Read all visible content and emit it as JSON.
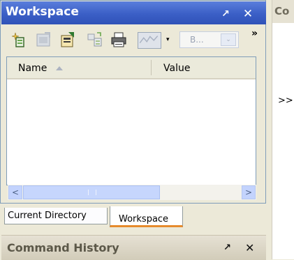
{
  "workspace": {
    "title": "Workspace",
    "undock_glyph": "↗",
    "close_glyph": "✕",
    "toolbar": {
      "icons": [
        "new-variable-icon",
        "import-data-icon",
        "save-icon",
        "open-selection-icon",
        "print-icon",
        "plot-selection-icon"
      ],
      "plot_dropdown_glyph": "▾",
      "base_select": {
        "value": "B...",
        "arrow": "⌄"
      },
      "overflow_glyph": "»"
    },
    "columns": [
      {
        "label": "Name",
        "sorted": "ascending"
      },
      {
        "label": "Value"
      }
    ],
    "scrollbar": {
      "left_glyph": "<",
      "right_glyph": ">"
    }
  },
  "tabs": [
    {
      "label": "Current Directory",
      "active": false
    },
    {
      "label": "Workspace",
      "active": true
    }
  ],
  "command_history": {
    "title": "Command History",
    "undock_glyph": "↗",
    "close_glyph": "✕"
  },
  "command_window": {
    "title": "Co",
    "prompt": ">>"
  },
  "colors": {
    "active_title": "#3b5fc6",
    "tab_highlight": "#e68b2c",
    "inactive_title": "#d2ccb9"
  }
}
